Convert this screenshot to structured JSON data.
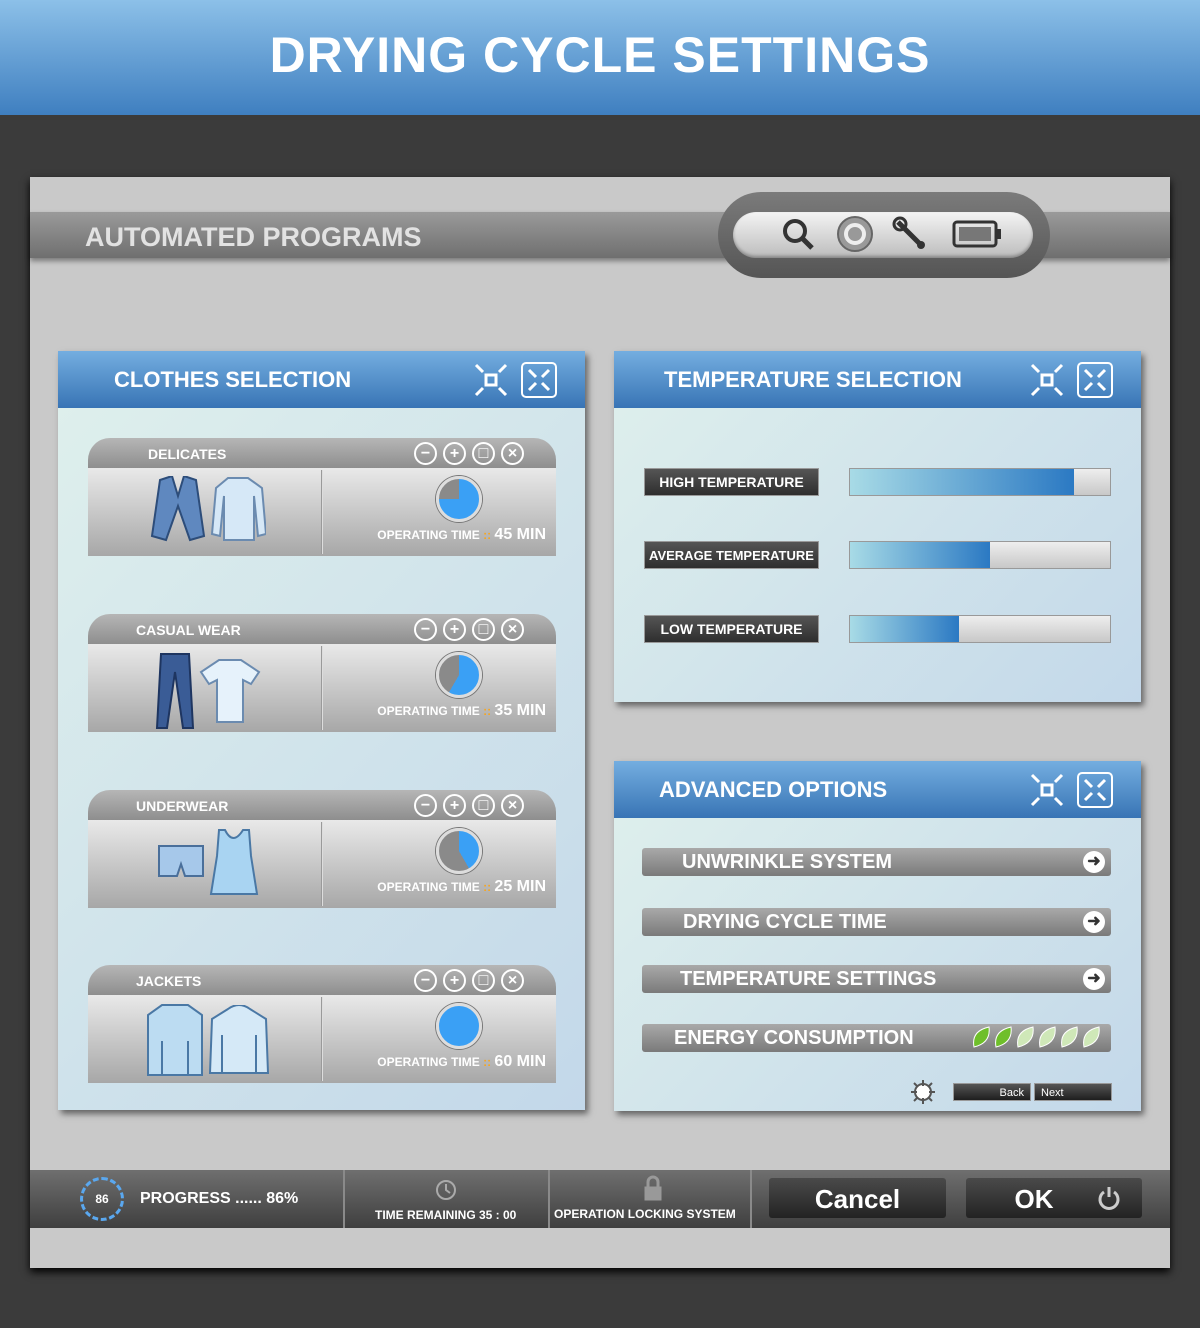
{
  "title": "DRYING CYCLE SETTINGS",
  "programs_bar": {
    "title": "AUTOMATED PROGRAMS",
    "toolbar_icons": [
      "search-icon",
      "refresh-icon",
      "wrench-icon",
      "battery-icon"
    ]
  },
  "clothes": {
    "title": "CLOTHES SELECTION",
    "operating_label": "OPERATING TIME",
    "separator": "::",
    "items": [
      {
        "name": "DELICATES",
        "time": "45 MIN",
        "minutes": 45,
        "icons": [
          "blazer-icon",
          "shirt-icon"
        ]
      },
      {
        "name": "CASUAL WEAR",
        "time": "35 MIN",
        "minutes": 35,
        "icons": [
          "jeans-icon",
          "tshirt-icon"
        ]
      },
      {
        "name": "UNDERWEAR",
        "time": "25 MIN",
        "minutes": 25,
        "icons": [
          "shorts-icon",
          "tanktop-icon"
        ]
      },
      {
        "name": "JACKETS",
        "time": "60 MIN",
        "minutes": 60,
        "icons": [
          "coat-icon",
          "hoodie-icon"
        ]
      }
    ]
  },
  "temperature": {
    "title": "TEMPERATURE SELECTION",
    "levels": [
      {
        "label": "HIGH TEMPERATURE",
        "percent": 86
      },
      {
        "label": "AVERAGE TEMPERATURE",
        "percent": 54
      },
      {
        "label": "LOW TEMPERATURE",
        "percent": 42
      }
    ]
  },
  "advanced": {
    "title": "ADVANCED OPTIONS",
    "options": [
      "UNWRINKLE SYSTEM",
      "DRYING CYCLE TIME",
      "TEMPERATURE SETTINGS"
    ],
    "energy": {
      "label": "ENERGY CONSUMPTION",
      "leaves_active": 2,
      "leaves_total": 6
    },
    "back": "Back",
    "next": "Next"
  },
  "status": {
    "progress_value": "86",
    "progress_label": "PROGRESS ...... 86%",
    "time_remaining": "TIME REMAINING 35 : 00",
    "locking": "OPERATION LOCKING SYSTEM",
    "cancel": "Cancel",
    "ok": "OK"
  },
  "colors": {
    "accent": "#3874b5",
    "header": "#5b9bd5",
    "orange": "#f5a623",
    "leaf": "#6fbf2a"
  }
}
